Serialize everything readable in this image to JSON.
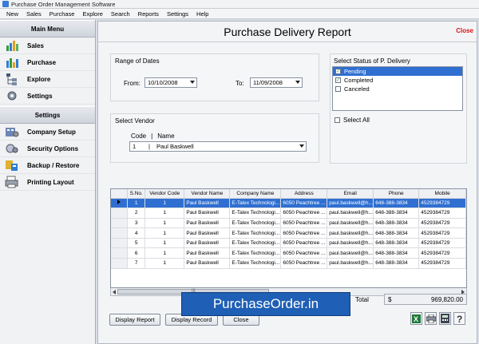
{
  "window": {
    "title": "Purchase Order Management Software"
  },
  "menu": [
    "New",
    "Sales",
    "Purchase",
    "Explore",
    "Search",
    "Reports",
    "Settings",
    "Help"
  ],
  "sidebar": {
    "main_menu_title": "Main Menu",
    "main_items": [
      {
        "label": "Sales",
        "icon": "sales-chart-icon"
      },
      {
        "label": "Purchase",
        "icon": "purchase-chart-icon"
      },
      {
        "label": "Explore",
        "icon": "explore-tree-icon"
      },
      {
        "label": "Settings",
        "icon": "settings-gear-icon"
      }
    ],
    "settings_title": "Settings",
    "settings_items": [
      {
        "label": "Company Setup",
        "icon": "company-setup-icon"
      },
      {
        "label": "Security Options",
        "icon": "security-options-icon"
      },
      {
        "label": "Backup / Restore",
        "icon": "backup-restore-icon"
      },
      {
        "label": "Printing Layout",
        "icon": "printing-layout-icon"
      }
    ]
  },
  "report": {
    "title": "Purchase Delivery Report",
    "close_label": "Close",
    "range_label": "Range of Dates",
    "from_label": "From:",
    "from_value": "10/10/2008",
    "to_label": "To:",
    "to_value": "11/09/2008",
    "status_label": "Select Status of P. Delivery",
    "status_options": [
      {
        "label": "Pending",
        "checked": true,
        "selected": true
      },
      {
        "label": "Completed",
        "checked": true,
        "selected": false
      },
      {
        "label": "Canceled",
        "checked": false,
        "selected": false
      }
    ],
    "select_all_label": "Select All",
    "vendor_label": "Select Vendor",
    "vendor_code_header": "Code",
    "vendor_name_header": "Name",
    "vendor_code": "1",
    "vendor_name": "Paul Baskwell"
  },
  "table": {
    "columns": [
      "S.No.",
      "Vendor Code",
      "Vendor Name",
      "Company Name",
      "Address",
      "Email",
      "Phone",
      "Mobile"
    ],
    "rows": [
      [
        "1",
        "1",
        "Paul Baskwell",
        "E-Talex Technologi...",
        "6050 Peachtree ...",
        "paul.baskwell@h...",
        "648-388-3834",
        "4529384729"
      ],
      [
        "2",
        "1",
        "Paul Baskwell",
        "E-Talex Technologi...",
        "6050 Peachtree ...",
        "paul.baskwell@h...",
        "648-388-3834",
        "4529384729"
      ],
      [
        "3",
        "1",
        "Paul Baskwell",
        "E-Talex Technologi...",
        "6050 Peachtree ...",
        "paul.baskwell@h...",
        "648-388-3834",
        "4529384729"
      ],
      [
        "4",
        "1",
        "Paul Baskwell",
        "E-Talex Technologi...",
        "6050 Peachtree ...",
        "paul.baskwell@h...",
        "648-388-3834",
        "4529384729"
      ],
      [
        "5",
        "1",
        "Paul Baskwell",
        "E-Talex Technologi...",
        "6050 Peachtree ...",
        "paul.baskwell@h...",
        "648-388-3834",
        "4529384729"
      ],
      [
        "6",
        "1",
        "Paul Baskwell",
        "E-Talex Technologi...",
        "6050 Peachtree ...",
        "paul.baskwell@h...",
        "648-388-3834",
        "4529384729"
      ],
      [
        "7",
        "1",
        "Paul Baskwell",
        "E-Talex Technologi...",
        "6050 Peachtree ...",
        "paul.baskwell@h...",
        "648-388-3834",
        "4529384729"
      ]
    ],
    "selected_row": 0
  },
  "total": {
    "label": "Total",
    "currency": "$",
    "value": "969,820.00"
  },
  "buttons": {
    "display_report": "Display Report",
    "display_record": "Display Record",
    "close": "Close"
  },
  "watermark": "PurchaseOrder.in",
  "toolbar_icons": [
    "excel-export-icon",
    "print-icon",
    "calculator-icon",
    "help-icon"
  ],
  "colors": {
    "selection": "#2f6fd1",
    "close": "#dd1111",
    "watermark": "#1f5fb5"
  }
}
